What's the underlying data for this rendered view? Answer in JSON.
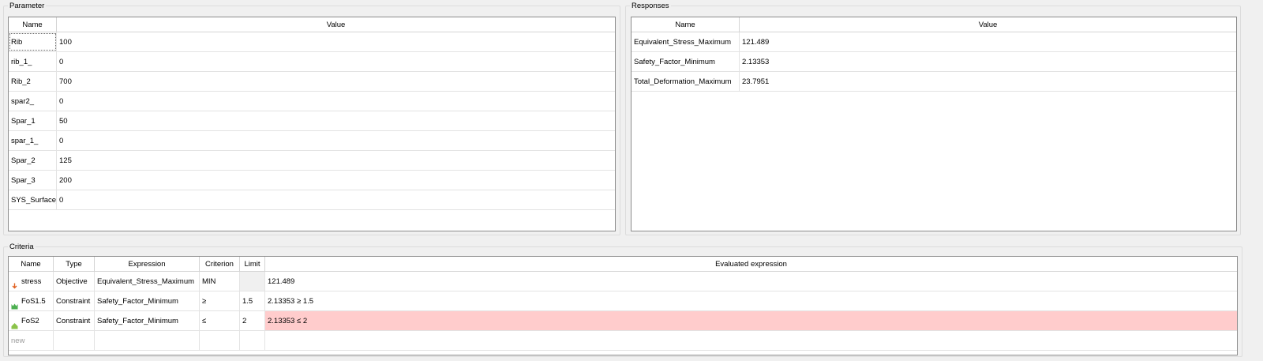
{
  "parameter": {
    "title": "Parameter",
    "columns": {
      "name": "Name",
      "value": "Value"
    },
    "rows": [
      {
        "name": "Rib",
        "value": "100"
      },
      {
        "name": "rib_1_",
        "value": "0"
      },
      {
        "name": "Rib_2",
        "value": "700"
      },
      {
        "name": "spar2_",
        "value": "0"
      },
      {
        "name": "Spar_1",
        "value": "50"
      },
      {
        "name": "spar_1_",
        "value": "0"
      },
      {
        "name": "Spar_2",
        "value": "125"
      },
      {
        "name": "Spar_3",
        "value": "200"
      },
      {
        "name": "SYS_Surface_",
        "value": "0"
      }
    ]
  },
  "responses": {
    "title": "Responses",
    "columns": {
      "name": "Name",
      "value": "Value"
    },
    "rows": [
      {
        "name": "Equivalent_Stress_Maximum",
        "value": "121.489"
      },
      {
        "name": "Safety_Factor_Minimum",
        "value": "2.13353"
      },
      {
        "name": "Total_Deformation_Maximum",
        "value": "23.7951"
      }
    ]
  },
  "criteria": {
    "title": "Criteria",
    "columns": {
      "name": "Name",
      "type": "Type",
      "expression": "Expression",
      "criterion": "Criterion",
      "limit": "Limit",
      "evaluated": "Evaluated expression"
    },
    "rows": [
      {
        "icon": "objective-icon",
        "name": "stress",
        "type": "Objective",
        "expression": "Equivalent_Stress_Maximum",
        "criterion": "MIN",
        "limit": "",
        "evaluated": "121.489",
        "status": "none"
      },
      {
        "icon": "constraint-satisfied-icon",
        "name": "FoS1.5",
        "type": "Constraint",
        "expression": "Safety_Factor_Minimum",
        "criterion": "≥",
        "limit": "1.5",
        "evaluated": "2.13353 ≥ 1.5",
        "status": "ok"
      },
      {
        "icon": "constraint-violated-icon",
        "name": "FoS2",
        "type": "Constraint",
        "expression": "Safety_Factor_Minimum",
        "criterion": "≤",
        "limit": "2",
        "evaluated": "2.13353 ≤ 2",
        "status": "violated"
      }
    ],
    "new_row_label": "new"
  },
  "colors": {
    "violated_bg": "#ffcccc",
    "ok_icon": "#4caf50",
    "violated_icon": "#8bc34a",
    "objective_icon": "#e06020"
  }
}
